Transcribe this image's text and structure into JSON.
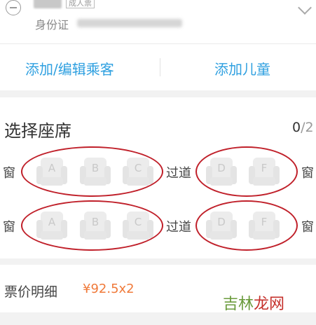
{
  "passenger": {
    "type_badge": "成人票",
    "id_label": "身份证"
  },
  "actions": {
    "add_edit": "添加/编辑乘客",
    "add_child": "添加儿童"
  },
  "seat_selection": {
    "title": "选择座席",
    "selected": "0",
    "total": "/2",
    "window_label": "窗",
    "aisle_label": "过道",
    "rows": [
      {
        "left": [
          "A",
          "B",
          "C"
        ],
        "right": [
          "D",
          "F"
        ]
      },
      {
        "left": [
          "A",
          "B",
          "C"
        ],
        "right": [
          "D",
          "F"
        ]
      }
    ],
    "highlight_color": "#c0202a"
  },
  "price": {
    "label": "票价明细",
    "value": "¥92.5x2"
  },
  "watermark": {
    "part1": "吉林",
    "part2": "龙网"
  },
  "icons": {
    "remove": "minus-circle-icon",
    "expand": "chevron-down-icon"
  },
  "colors": {
    "link": "#2fa0e0",
    "price": "#f07a3a"
  }
}
